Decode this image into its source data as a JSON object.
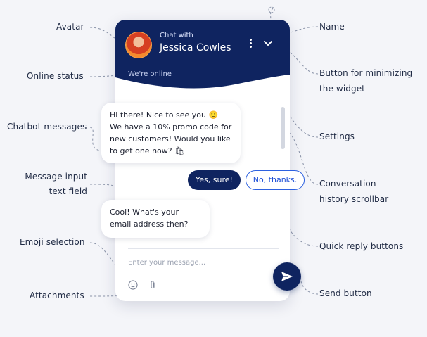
{
  "widget": {
    "header": {
      "chat_with": "Chat with",
      "agent_name": "Jessica Cowles",
      "online_status": "We're online"
    },
    "messages": [
      {
        "from": "bot",
        "text": "Hi there! Nice to see you 🙂 We have a 10% promo code for new customers! Would you like to get one now? 🛍"
      },
      {
        "from": "bot",
        "text": "Cool! What's your email address then?"
      }
    ],
    "quick_replies": [
      "Yes, sure!",
      "No, thanks."
    ],
    "input_placeholder": "Enter your message...",
    "colors": {
      "header": "#0f2460",
      "accent": "#2d61e0",
      "background": "#f4f5f9"
    }
  },
  "annotations": {
    "avatar": "Avatar",
    "online_status": "Online status",
    "chatbot_messages": "Chatbot messages",
    "message_input": [
      "Message input",
      "text field"
    ],
    "emoji_selection": "Emoji selection",
    "attachments": "Attachments",
    "name": "Name",
    "minimize": [
      "Button for minimizing",
      "the widget"
    ],
    "settings": "Settings",
    "scrollbar": [
      "Conversation",
      "history scrollbar"
    ],
    "quick_reply": "Quick reply buttons",
    "send": "Send button"
  }
}
